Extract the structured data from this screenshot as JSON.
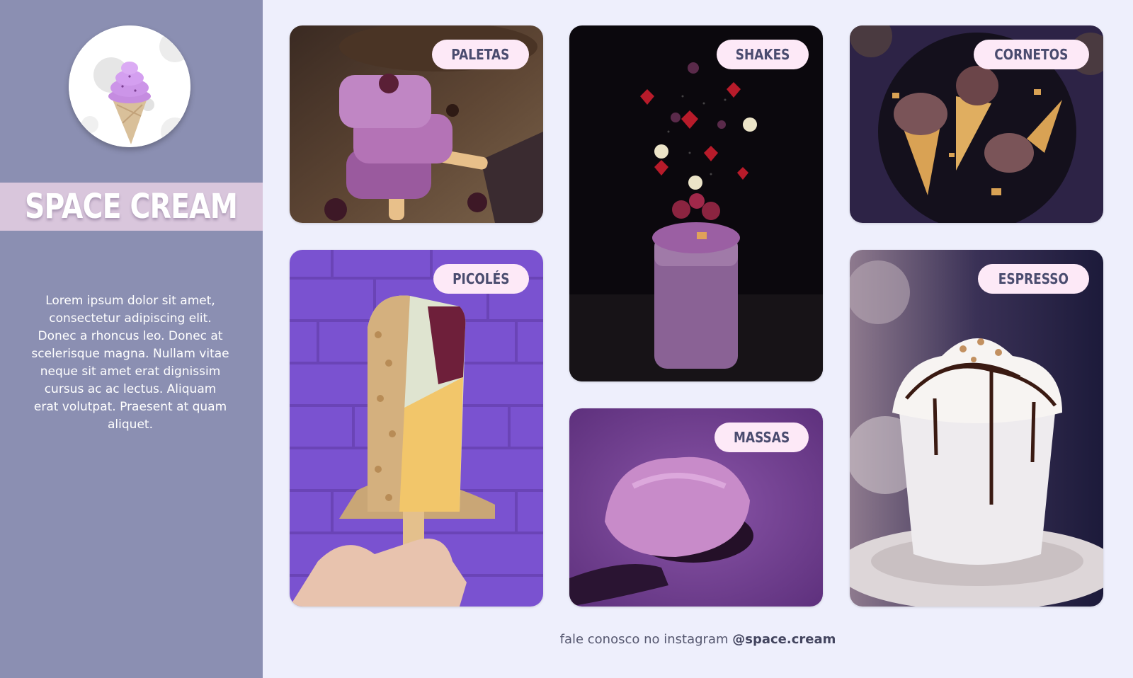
{
  "brand": {
    "name": "SPACE CREAM",
    "logo_icon": "ice-cream-cone-icon"
  },
  "sidebar": {
    "description": "Lorem ipsum dolor sit amet, consectetur adipiscing elit. Donec a rhoncus leo. Donec at scelerisque magna. Nullam vitae neque sit amet erat dignissim cursus ac ac lectus. Aliquam erat volutpat. Praesent at quam aliquet."
  },
  "categories": [
    {
      "id": "paletas",
      "label": "PALETAS"
    },
    {
      "id": "shakes",
      "label": "SHAKES"
    },
    {
      "id": "cornetos",
      "label": "CORNETOS"
    },
    {
      "id": "picoles",
      "label": "PICOLÉS"
    },
    {
      "id": "massas",
      "label": "MASSAS"
    },
    {
      "id": "espresso",
      "label": "ESPRESSO"
    }
  ],
  "footer": {
    "text": "fale conosco no instagram",
    "handle": "@space.cream"
  },
  "colors": {
    "sidebar_bg": "#8b8fb2",
    "title_band": "#d9c6dc",
    "page_bg": "#eeeffc",
    "pill_bg": "#fde9f7",
    "pill_text": "#4a4c6f"
  }
}
